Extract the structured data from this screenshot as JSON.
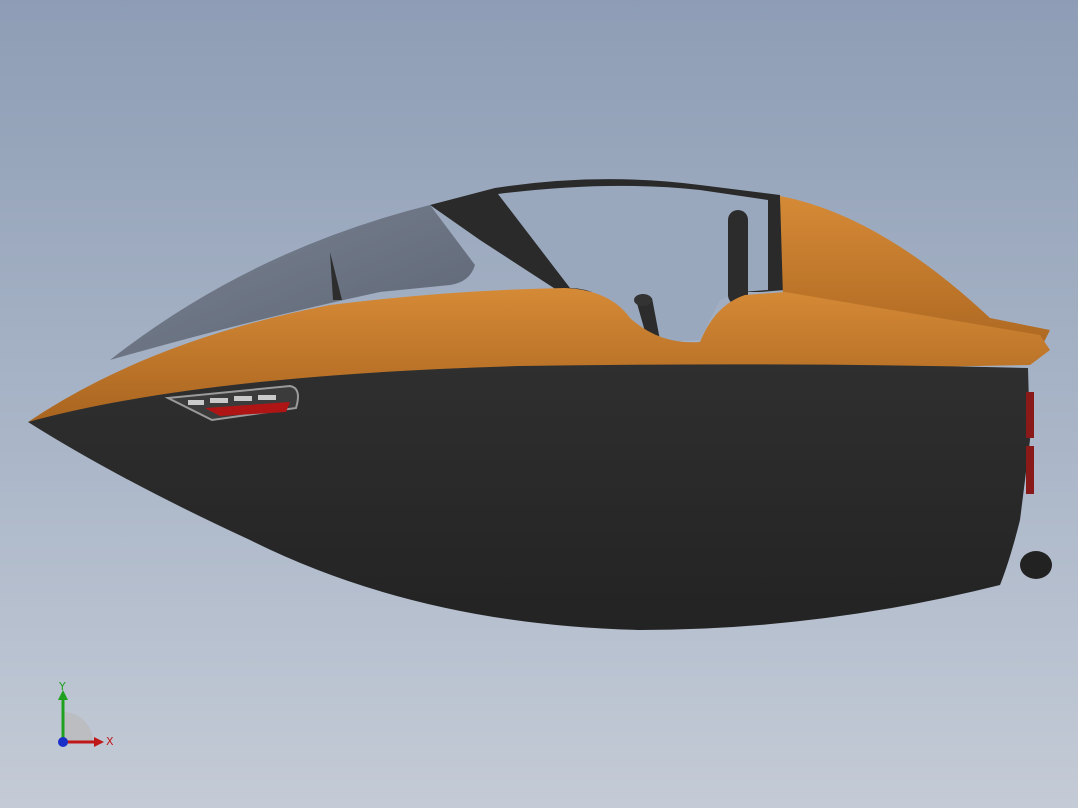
{
  "viewport": {
    "background_top": "#8e9db5",
    "background_bottom": "#c4cbd6"
  },
  "model": {
    "body_color": "#2b2b2b",
    "trim_color": "#c07a2c",
    "glass_color": "#6e7788",
    "accent_color": "#b01515"
  },
  "triad": {
    "y_label": "Y",
    "x_label": "X",
    "y_color": "#1fa11f",
    "x_color": "#c01818",
    "z_color": "#1a2fc8"
  }
}
